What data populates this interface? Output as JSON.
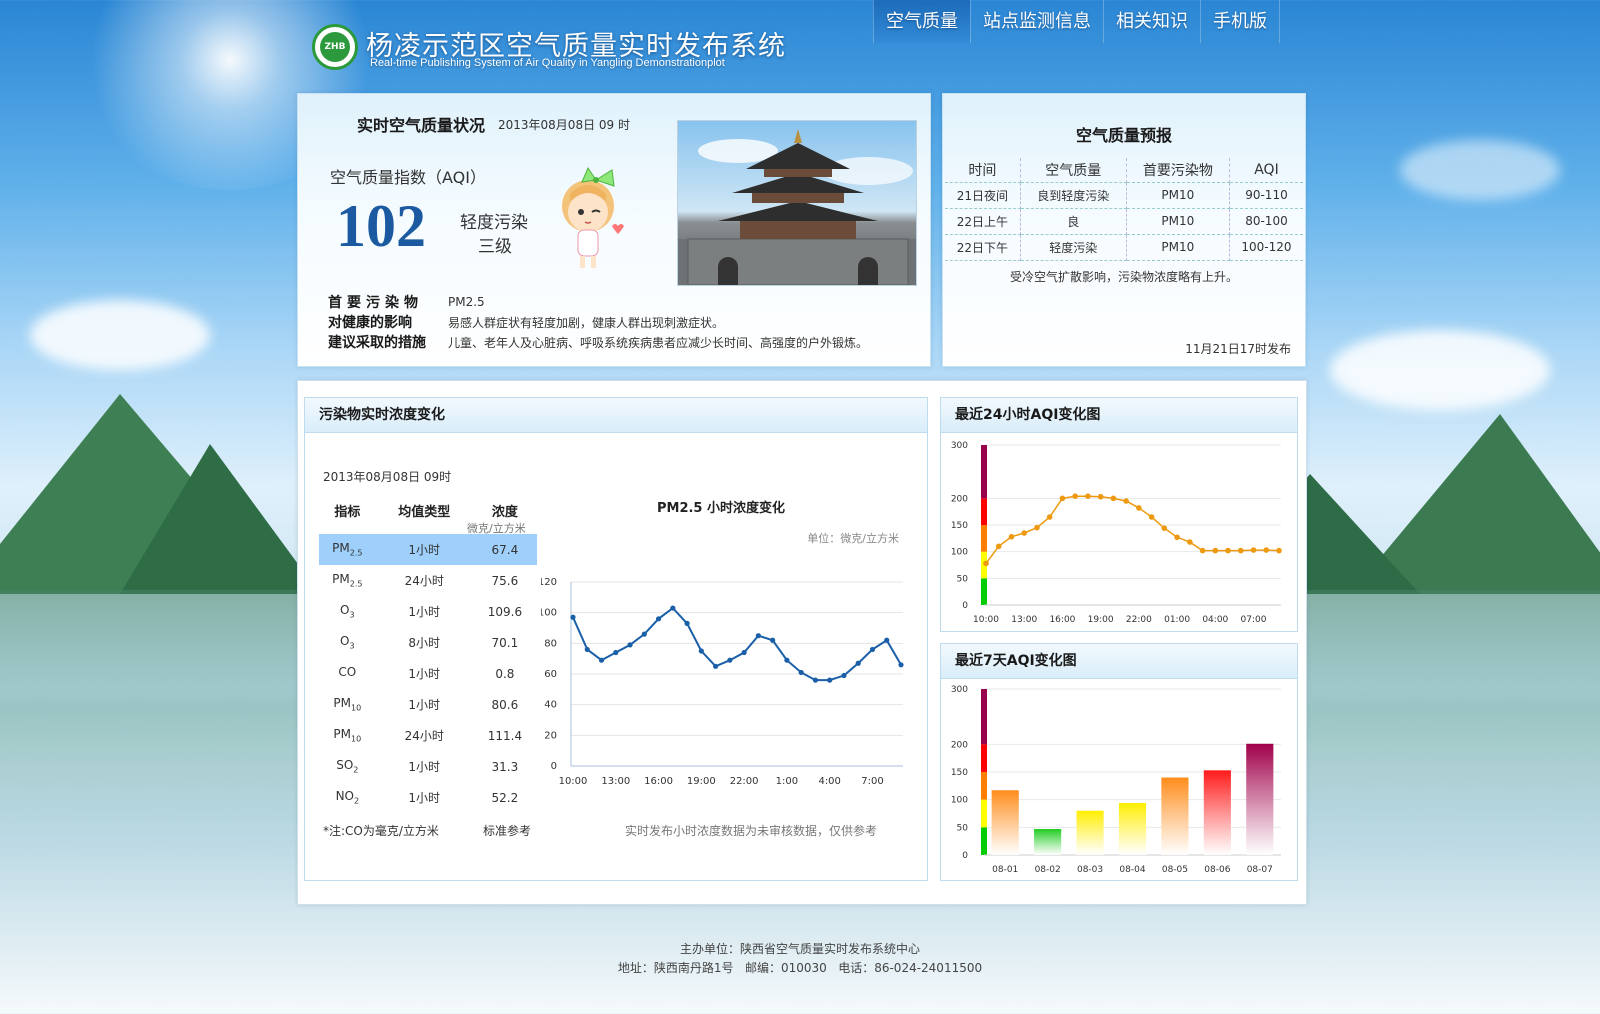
{
  "header": {
    "title": "杨凌示范区空气质量实时发布系统",
    "subtitle": "Real-time Publishing System of Air Quality in Yangling Demonstrationplot",
    "nav": [
      "空气质量",
      "站点监测信息",
      "相关知识",
      "手机版"
    ]
  },
  "realtime": {
    "title": "实时空气质量状况",
    "time": "2013年08月08日 09 时",
    "aqi_label": "空气质量指数（AQI）",
    "aqi_value": "102",
    "level": "轻度污染",
    "grade": "三级",
    "primary_label": "首要污染物",
    "primary_value": "PM2.5",
    "health_label": "对健康的影响",
    "health_value": "易感人群症状有轻度加剧，健康人群出现刺激症状。",
    "advice_label": "建议采取的措施",
    "advice_value": "儿童、老年人及心脏病、呼吸系统疾病患者应减少长时间、高强度的户外锻炼。"
  },
  "forecast": {
    "title": "空气质量预报",
    "headers": [
      "时间",
      "空气质量",
      "首要污染物",
      "AQI"
    ],
    "rows": [
      [
        "21日夜间",
        "良到轻度污染",
        "PM10",
        "90-110"
      ],
      [
        "22日上午",
        "良",
        "PM10",
        "80-100"
      ],
      [
        "22日下午",
        "轻度污染",
        "PM10",
        "100-120"
      ]
    ],
    "note": "受冷空气扩散影响，污染物浓度略有上升。",
    "published": "11月21日17时发布"
  },
  "pollutants": {
    "title": "污染物实时浓度变化",
    "date": "2013年08月08日 09时",
    "headers": [
      "指标",
      "均值类型",
      "浓度"
    ],
    "unit_sub": "微克/立方米",
    "rows": [
      {
        "name": "PM",
        "sub": "2.5",
        "type": "1小时",
        "value": "67.4"
      },
      {
        "name": "PM",
        "sub": "2.5",
        "type": "24小时",
        "value": "75.6"
      },
      {
        "name": "O",
        "sub": "3",
        "type": "1小时",
        "value": "109.6"
      },
      {
        "name": "O",
        "sub": "3",
        "type": "8小时",
        "value": "70.1"
      },
      {
        "name": "CO",
        "sub": "",
        "type": "1小时",
        "value": "0.8"
      },
      {
        "name": "PM",
        "sub": "10",
        "type": "1小时",
        "value": "80.6"
      },
      {
        "name": "PM",
        "sub": "10",
        "type": "24小时",
        "value": "111.4"
      },
      {
        "name": "SO",
        "sub": "2",
        "type": "1小时",
        "value": "31.3"
      },
      {
        "name": "NO",
        "sub": "2",
        "type": "1小时",
        "value": "52.2"
      }
    ],
    "note": "*注:CO为毫克/立方米",
    "ref": "标准参考",
    "chart_footnote": "实时发布小时浓度数据为未审核数据，仅供参考"
  },
  "aqi24": {
    "title": "最近24小时AQI变化图"
  },
  "aqi7": {
    "title": "最近7天AQI变化图"
  },
  "footer": {
    "line1": "主办单位：陕西省空气质量实时发布系统中心",
    "line2": "地址：陕西南丹路1号   邮编：010030   电话：86-024-24011500"
  },
  "chart_data": [
    {
      "type": "line",
      "title": "PM2.5 小时浓度变化",
      "unit_label": "单位：微克/立方米",
      "x": [
        "10:00",
        "11:00",
        "12:00",
        "13:00",
        "14:00",
        "15:00",
        "16:00",
        "17:00",
        "18:00",
        "19:00",
        "20:00",
        "21:00",
        "22:00",
        "23:00",
        "0:00",
        "1:00",
        "2:00",
        "3:00",
        "4:00",
        "5:00",
        "6:00",
        "7:00",
        "8:00",
        "9:00"
      ],
      "x_ticks": [
        "10:00",
        "13:00",
        "16:00",
        "19:00",
        "22:00",
        "1:00",
        "4:00",
        "7:00"
      ],
      "values": [
        97,
        76,
        69,
        74,
        79,
        86,
        96,
        103,
        93,
        75,
        65,
        69,
        74,
        85,
        82,
        69,
        61,
        56,
        56,
        59,
        67,
        76,
        82,
        66
      ],
      "ylim": [
        0,
        120
      ],
      "y_ticks": [
        0,
        20,
        40,
        60,
        80,
        100,
        120
      ],
      "color": "#1a5fa8"
    },
    {
      "type": "line",
      "title": "最近24小时AQI变化图",
      "x": [
        "10:00",
        "11:00",
        "12:00",
        "13:00",
        "14:00",
        "15:00",
        "16:00",
        "17:00",
        "18:00",
        "19:00",
        "20:00",
        "21:00",
        "22:00",
        "23:00",
        "00:00",
        "01:00",
        "02:00",
        "03:00",
        "04:00",
        "05:00",
        "06:00",
        "07:00",
        "08:00",
        "09:00"
      ],
      "x_ticks": [
        "10:00",
        "13:00",
        "16:00",
        "19:00",
        "22:00",
        "01:00",
        "04:00",
        "07:00"
      ],
      "values": [
        78,
        110,
        128,
        135,
        145,
        165,
        200,
        204,
        204,
        203,
        200,
        195,
        182,
        165,
        144,
        127,
        118,
        102,
        102,
        102,
        102,
        103,
        103,
        102
      ],
      "ylim": [
        0,
        300
      ],
      "y_ticks": [
        0,
        50,
        100,
        150,
        200,
        300
      ],
      "color": "#ee9a10"
    },
    {
      "type": "bar",
      "title": "最近7天AQI变化图",
      "categories": [
        "08-01",
        "08-02",
        "08-03",
        "08-04",
        "08-05",
        "08-06",
        "08-07"
      ],
      "values": [
        117,
        47,
        80,
        94,
        140,
        153,
        201
      ],
      "colors": [
        "#ff8c1a",
        "#22cc22",
        "#ffee00",
        "#ffee00",
        "#ff8c1a",
        "#ff1a1a",
        "#a0004a"
      ],
      "ylim": [
        0,
        300
      ],
      "y_ticks": [
        0,
        50,
        100,
        150,
        200,
        300
      ]
    }
  ],
  "colors": {
    "aqi_value": "#1b5aa0",
    "pm_line": "#1a5fa8",
    "aqi24_line": "#ee9a10",
    "selected_row": "#9fd0fb",
    "aqi_scale": [
      "#00cc00",
      "#ffff00",
      "#ff7e00",
      "#ff0000",
      "#99004c",
      "#7e0023"
    ]
  }
}
